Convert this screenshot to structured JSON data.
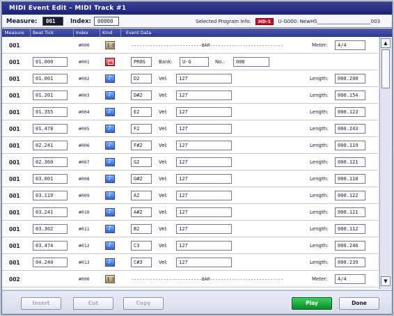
{
  "window": {
    "title": "MIDI Event Edit – MIDI Track #1"
  },
  "info": {
    "measure_label": "Measure:",
    "measure_value": "001",
    "index_label": "Index:",
    "index_value": "00000",
    "selected_program_label": "Selected Program Info:",
    "program_badge": "HD-1",
    "program_text": "U-G000: NewHS______________________003"
  },
  "columns": {
    "measure": "Measure",
    "beat_tick": "Beat Tick",
    "index": "Index",
    "kind": "Kind",
    "event_data": "Event Data"
  },
  "labels": {
    "vel": "Vel:",
    "length": "Length:",
    "meter": "Meter:",
    "bank": "Bank:",
    "no": "No.:"
  },
  "rows": [
    {
      "type": "bar",
      "measure": "001",
      "beat": "",
      "index": "#000",
      "kind": "bar-icon",
      "dashed": "--------------------------BAR---------------------------",
      "meter": "4/4"
    },
    {
      "type": "prog",
      "measure": "001",
      "beat": "01.000",
      "index": "#001",
      "kind": "program-icon",
      "prog": "PROG",
      "bank": "U-G",
      "no": "000"
    },
    {
      "type": "note",
      "measure": "001",
      "beat": "01.001",
      "index": "#002",
      "kind": "note-icon",
      "note": "D2",
      "vel": "127",
      "length": "000.200"
    },
    {
      "type": "note",
      "measure": "001",
      "beat": "01.201",
      "index": "#003",
      "kind": "note-icon",
      "note": "D#2",
      "vel": "127",
      "length": "000.154"
    },
    {
      "type": "note",
      "measure": "001",
      "beat": "01.355",
      "index": "#004",
      "kind": "note-icon",
      "note": "E2",
      "vel": "127",
      "length": "000.123"
    },
    {
      "type": "note",
      "measure": "001",
      "beat": "01.478",
      "index": "#005",
      "kind": "note-icon",
      "note": "F2",
      "vel": "127",
      "length": "000.243"
    },
    {
      "type": "note",
      "measure": "001",
      "beat": "02.241",
      "index": "#006",
      "kind": "note-icon",
      "note": "F#2",
      "vel": "127",
      "length": "000.119"
    },
    {
      "type": "note",
      "measure": "001",
      "beat": "02.360",
      "index": "#007",
      "kind": "note-icon",
      "note": "G2",
      "vel": "127",
      "length": "000.121"
    },
    {
      "type": "note",
      "measure": "001",
      "beat": "03.001",
      "index": "#008",
      "kind": "note-icon",
      "note": "G#2",
      "vel": "127",
      "length": "000.118"
    },
    {
      "type": "note",
      "measure": "001",
      "beat": "03.119",
      "index": "#009",
      "kind": "note-icon",
      "note": "A2",
      "vel": "127",
      "length": "000.122"
    },
    {
      "type": "note",
      "measure": "001",
      "beat": "03.241",
      "index": "#010",
      "kind": "note-icon",
      "note": "A#2",
      "vel": "127",
      "length": "000.121"
    },
    {
      "type": "note",
      "measure": "001",
      "beat": "03.362",
      "index": "#011",
      "kind": "note-icon",
      "note": "B2",
      "vel": "127",
      "length": "000.112"
    },
    {
      "type": "note",
      "measure": "001",
      "beat": "03.474",
      "index": "#012",
      "kind": "note-icon",
      "note": "C3",
      "vel": "127",
      "length": "000.246"
    },
    {
      "type": "note",
      "measure": "001",
      "beat": "04.240",
      "index": "#013",
      "kind": "note-icon",
      "note": "C#3",
      "vel": "127",
      "length": "000.239"
    },
    {
      "type": "bar",
      "measure": "002",
      "beat": "",
      "index": "#000",
      "kind": "bar-icon",
      "dashed": "--------------------------BAR---------------------------",
      "meter": "4/4"
    }
  ],
  "buttons": {
    "insert": "Insert",
    "cut": "Cut",
    "copy": "Copy",
    "play": "Play",
    "done": "Done"
  },
  "scroll": {
    "up_icon": "arrow-up-icon",
    "down_icon": "arrow-down-icon"
  }
}
